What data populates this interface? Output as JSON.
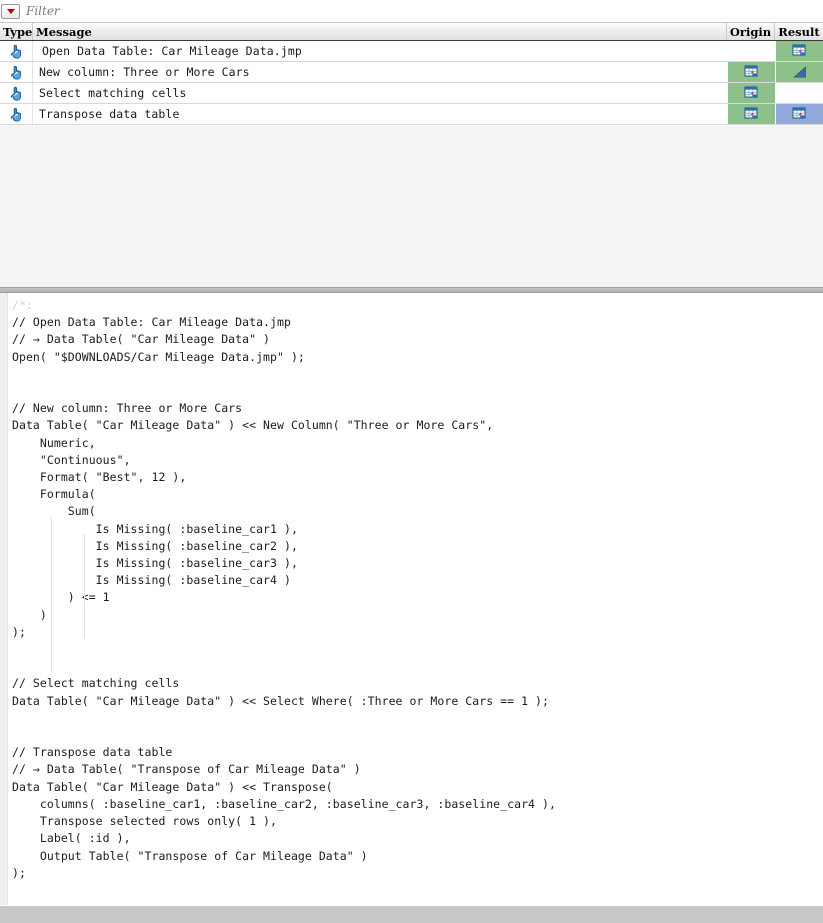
{
  "filter": {
    "placeholder": "Filter",
    "value": "",
    "dropdown_icon": "triangle-down-icon",
    "dropdown_color": "#c00000"
  },
  "log": {
    "columns": [
      "Type",
      "Message",
      "Origin",
      "Result"
    ],
    "rows": [
      {
        "type_icon": "hand-pointer-icon",
        "message": "Open Data Table: Car Mileage Data.jmp",
        "origin_icon": "",
        "origin_fill": "none",
        "result_icon": "data-table-icon",
        "result_fill": "green"
      },
      {
        "type_icon": "hand-pointer-icon",
        "message": "New column: Three or More Cars",
        "origin_icon": "data-table-icon",
        "origin_fill": "green",
        "result_icon": "distribution-triangle-icon",
        "result_fill": "green"
      },
      {
        "type_icon": "hand-pointer-icon",
        "message": "Select matching cells",
        "origin_icon": "data-table-icon",
        "origin_fill": "green",
        "result_icon": "",
        "result_fill": "none"
      },
      {
        "type_icon": "hand-pointer-icon",
        "message": "Transpose data table",
        "origin_icon": "data-table-icon",
        "origin_fill": "green",
        "result_icon": "data-table-icon",
        "result_fill": "blue"
      }
    ]
  },
  "colors": {
    "fill_green": "#8dc08a",
    "fill_blue": "#93a9da",
    "accent_red": "#c00000",
    "code_text": "#1c1c1c",
    "dim_text": "#d2d2d2"
  },
  "code": {
    "dim_first_line": "/*:",
    "body": "\n// Open Data Table: Car Mileage Data.jmp\n// → Data Table( \"Car Mileage Data\" )\nOpen( \"$DOWNLOADS/Car Mileage Data.jmp\" );\n\n\n// New column: Three or More Cars\nData Table( \"Car Mileage Data\" ) << New Column( \"Three or More Cars\",\n    Numeric,\n    \"Continuous\",\n    Format( \"Best\", 12 ),\n    Formula(\n        Sum(\n            Is Missing( :baseline_car1 ),\n            Is Missing( :baseline_car2 ),\n            Is Missing( :baseline_car3 ),\n            Is Missing( :baseline_car4 )\n        ) <= 1\n    )\n);\n\n\n// Select matching cells\nData Table( \"Car Mileage Data\" ) << Select Where( :Three or More Cars == 1 );\n\n\n// Transpose data table\n// → Data Table( \"Transpose of Car Mileage Data\" )\nData Table( \"Car Mileage Data\" ) << Transpose(\n    columns( :baseline_car1, :baseline_car2, :baseline_car3, :baseline_car4 ),\n    Transpose selected rows only( 1 ),\n    Label( :id ),\n    Output Table( \"Transpose of Car Mileage Data\" )\n);"
  }
}
